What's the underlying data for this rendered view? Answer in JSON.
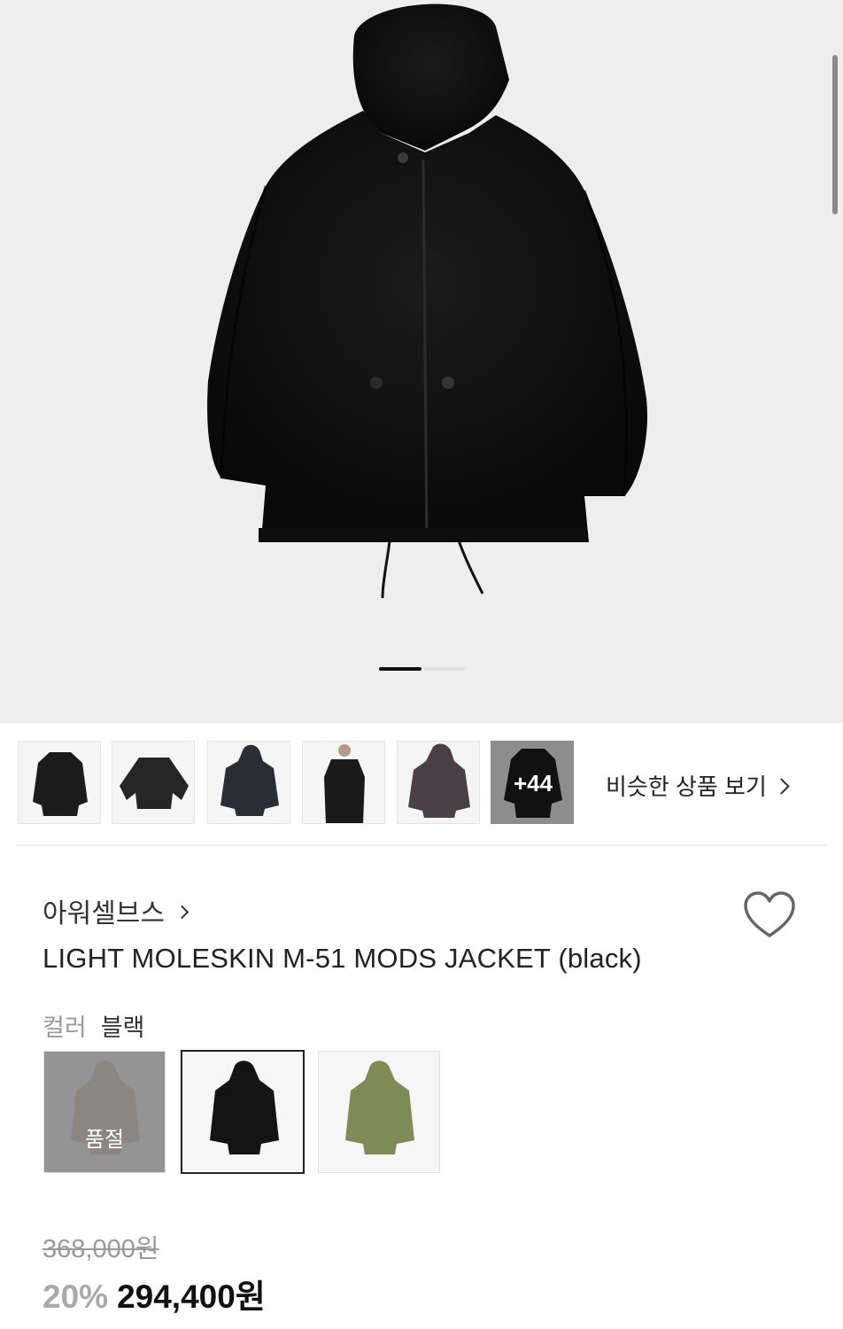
{
  "product_image": {
    "alt": "black hooded jacket",
    "slide_count": 2,
    "active_slide": 1
  },
  "thumbnails": [
    {
      "name": "thumb-long-coat",
      "color": "#1c1c1c"
    },
    {
      "name": "thumb-jacket-flat",
      "color": "#262626"
    },
    {
      "name": "thumb-navy-hoodie",
      "color": "#2b2d36"
    },
    {
      "name": "thumb-model",
      "color": "#1a1a1a"
    },
    {
      "name": "thumb-brown-hoodie",
      "color": "#4a4046"
    },
    {
      "name": "thumb-more",
      "color": "#111111"
    }
  ],
  "more_thumbs_label": "+44",
  "similar_link_label": "비슷한 상품 보기",
  "brand_name": "아워셀브스",
  "product_title": "LIGHT MOLESKIN M-51 MODS JACKET (black)",
  "color": {
    "label": "컬러",
    "value": "블랙"
  },
  "color_options": [
    {
      "color": "#c7bba9",
      "sold_out": true
    },
    {
      "color": "#141414",
      "sold_out": false
    },
    {
      "color": "#7f8a55",
      "sold_out": false
    }
  ],
  "soldout_label": "품절",
  "price": {
    "original": "368,000원",
    "discount": "20%",
    "sale": "294,400원"
  },
  "colors": {
    "hero_bg": "#eeeeee",
    "text_primary": "#222222",
    "text_muted": "#9a9a9a"
  }
}
